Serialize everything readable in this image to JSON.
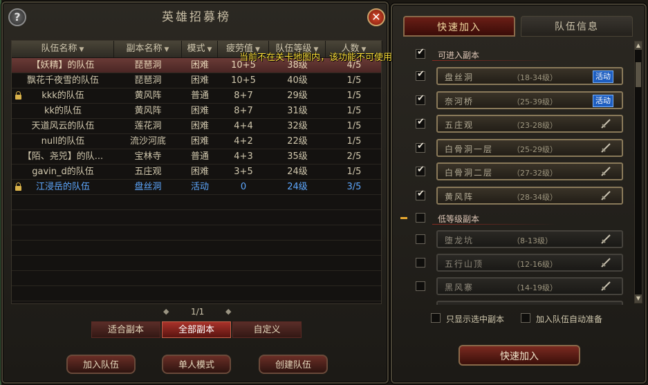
{
  "left": {
    "title": "英雄招募榜",
    "help_glyph": "?",
    "close_glyph": "✕",
    "columns": [
      "队伍名称",
      "副本名称",
      "模式",
      "疲劳值",
      "队伍等级",
      "人数"
    ],
    "tooltip": "当前不在关卡地图内，该功能不可使用",
    "rows": [
      {
        "team": "【妖精】的队伍",
        "dungeon": "琵琶洞",
        "mode": "困难",
        "fatigue": "10+5",
        "level": "38级",
        "count": "4/5",
        "locked": false,
        "selected": true,
        "blue": false
      },
      {
        "team": "飘花千夜雪的队伍",
        "dungeon": "琵琶洞",
        "mode": "困难",
        "fatigue": "10+5",
        "level": "40级",
        "count": "1/5",
        "locked": false,
        "selected": false,
        "blue": false
      },
      {
        "team": "kkk的队伍",
        "dungeon": "黄风阵",
        "mode": "普通",
        "fatigue": "8+7",
        "level": "29级",
        "count": "1/5",
        "locked": true,
        "selected": false,
        "blue": false
      },
      {
        "team": "kk的队伍",
        "dungeon": "黄风阵",
        "mode": "困难",
        "fatigue": "8+7",
        "level": "31级",
        "count": "1/5",
        "locked": false,
        "selected": false,
        "blue": false
      },
      {
        "team": "天道风云的队伍",
        "dungeon": "莲花洞",
        "mode": "困难",
        "fatigue": "4+4",
        "level": "32级",
        "count": "1/5",
        "locked": false,
        "selected": false,
        "blue": false
      },
      {
        "team": "null的队伍",
        "dungeon": "流沙河底",
        "mode": "困难",
        "fatigue": "4+2",
        "level": "22级",
        "count": "1/5",
        "locked": false,
        "selected": false,
        "blue": false
      },
      {
        "team": "【陌、尧兕】的队...",
        "dungeon": "宝林寺",
        "mode": "普通",
        "fatigue": "4+3",
        "level": "35级",
        "count": "2/5",
        "locked": false,
        "selected": false,
        "blue": false
      },
      {
        "team": "gavin_d的队伍",
        "dungeon": "五庄观",
        "mode": "困难",
        "fatigue": "3+5",
        "level": "24级",
        "count": "1/5",
        "locked": false,
        "selected": false,
        "blue": false
      },
      {
        "team": "江浸岳的队伍",
        "dungeon": "盘丝洞",
        "mode": "活动",
        "fatigue": "0",
        "level": "24级",
        "count": "3/5",
        "locked": true,
        "selected": false,
        "blue": true
      }
    ],
    "pager": {
      "prev": "◆",
      "page": "1/1",
      "next": "◆"
    },
    "filter_tabs": [
      "适合副本",
      "全部副本",
      "自定义"
    ],
    "buttons": {
      "join": "加入队伍",
      "solo": "单人模式",
      "create": "创建队伍"
    }
  },
  "right": {
    "tabs": [
      "快速加入",
      "队伍信息"
    ],
    "group1": "可进入副本",
    "group2": "低等级副本",
    "dungeons_available": [
      {
        "name": "盘丝洞",
        "levels": "（18-34级）",
        "badge": "活动"
      },
      {
        "name": "奈河桥",
        "levels": "（25-39级）",
        "badge": "活动"
      },
      {
        "name": "五庄观",
        "levels": "（23-28级）",
        "badge": ""
      },
      {
        "name": "白骨洞一层",
        "levels": "（25-29级）",
        "badge": ""
      },
      {
        "name": "白骨洞二层",
        "levels": "（27-32级）",
        "badge": ""
      },
      {
        "name": "黄风阵",
        "levels": "（28-34级）",
        "badge": ""
      }
    ],
    "dungeons_low": [
      {
        "name": "堕龙坑",
        "levels": "（8-13级）"
      },
      {
        "name": "五行山顶",
        "levels": "（12-16级）"
      },
      {
        "name": "黑风寨",
        "levels": "（14-19级）"
      }
    ],
    "option_selected_only": "只显示选中副本",
    "option_auto_ready": "加入队伍自动准备",
    "quick_join": "快速加入"
  },
  "colors": {
    "accent_red": "#a8322a",
    "activity_blue": "#5ea8ff",
    "badge_blue": "#1e5ec0",
    "tooltip_yellow": "#ffe23a"
  }
}
